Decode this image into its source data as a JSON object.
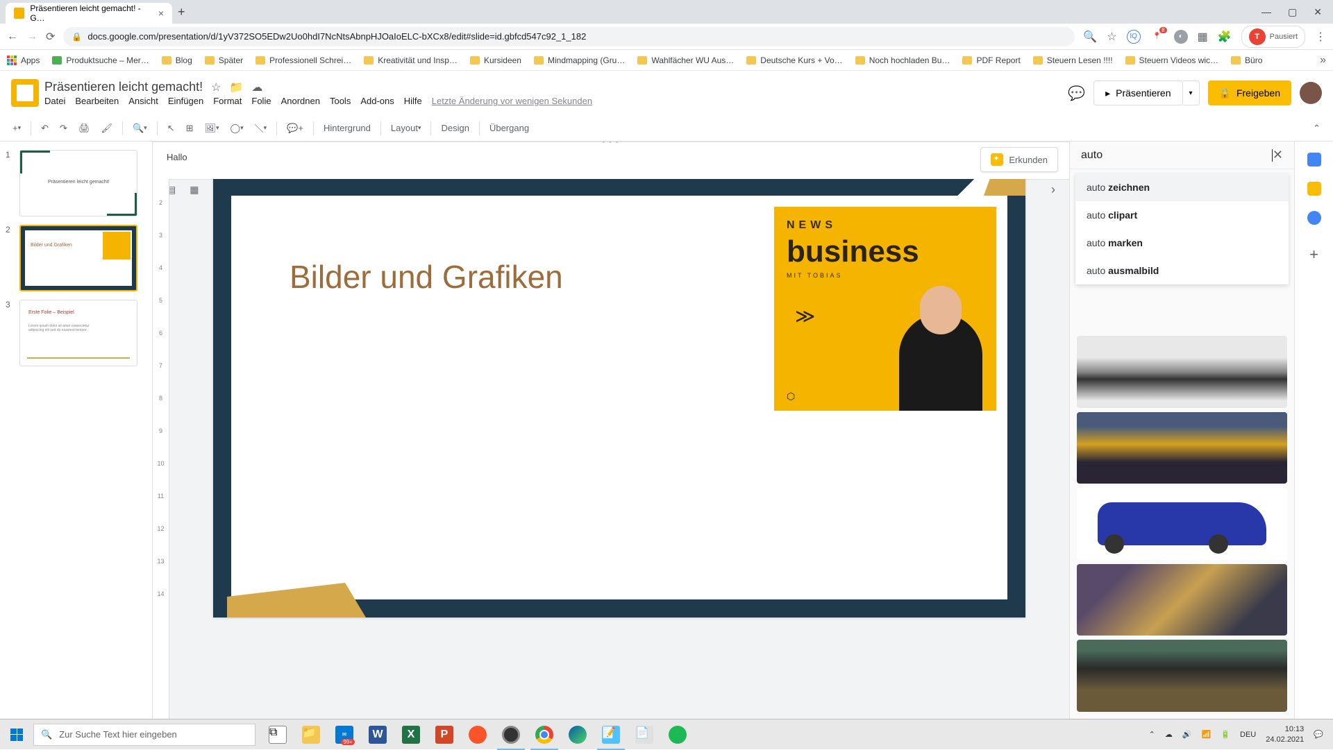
{
  "browser": {
    "tab_title": "Präsentieren leicht gemacht! - G…",
    "url": "docs.google.com/presentation/d/1yV372SO5EDw2Uo0hdI7NcNtsAbnpHJOaIoELC-bXCx8/edit#slide=id.gbfcd547c92_1_182",
    "pause_label": "Pausiert",
    "avatar_letter": "T"
  },
  "bookmarks": {
    "apps": "Apps",
    "items": [
      "Produktsuche – Mer…",
      "Blog",
      "Später",
      "Professionell Schrei…",
      "Kreativität und Insp…",
      "Kursideen",
      "Mindmapping (Gru…",
      "Wahlfächer WU Aus…",
      "Deutsche Kurs + Vo…",
      "Noch hochladen Bu…",
      "PDF Report",
      "Steuern Lesen !!!!",
      "Steuern Videos wic…",
      "Büro"
    ]
  },
  "doc": {
    "title": "Präsentieren leicht gemacht!",
    "menu": [
      "Datei",
      "Bearbeiten",
      "Ansicht",
      "Einfügen",
      "Format",
      "Folie",
      "Anordnen",
      "Tools",
      "Add-ons",
      "Hilfe"
    ],
    "last_edit": "Letzte Änderung vor wenigen Sekunden",
    "present": "Präsentieren",
    "share": "Freigeben"
  },
  "toolbar": {
    "background": "Hintergrund",
    "layout": "Layout",
    "design": "Design",
    "transition": "Übergang"
  },
  "thumbs": {
    "t1_text": "Präsentieren leicht gemacht!",
    "t2_text": "Bilder und Grafiken",
    "t3_text": "Erste Folie – Beispiel"
  },
  "slide": {
    "title": "Bilder und Grafiken",
    "news": "NEWS",
    "business": "business",
    "mit": "MIT TOBIAS"
  },
  "notes": "Hallo",
  "explore": {
    "button": "Erkunden",
    "search": "auto",
    "suggestions": [
      {
        "pre": "auto ",
        "bold": "zeichnen"
      },
      {
        "pre": "auto ",
        "bold": "clipart"
      },
      {
        "pre": "auto ",
        "bold": "marken"
      },
      {
        "pre": "auto ",
        "bold": "ausmalbild"
      }
    ]
  },
  "taskbar": {
    "search_placeholder": "Zur Suche Text hier eingeben",
    "badge": "99+",
    "lang": "DEU",
    "time": "10:13",
    "date": "24.02.2021"
  }
}
